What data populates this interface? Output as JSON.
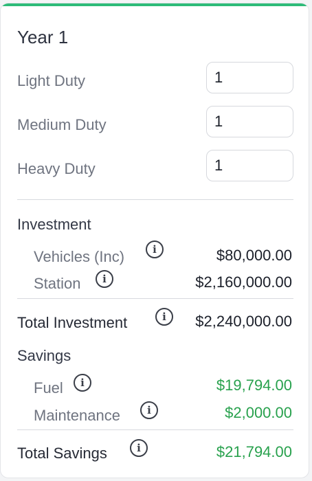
{
  "title": "Year 1",
  "inputs": [
    {
      "label": "Light Duty",
      "value": "1"
    },
    {
      "label": "Medium Duty",
      "value": "1"
    },
    {
      "label": "Heavy Duty",
      "value": "1"
    }
  ],
  "investment": {
    "heading": "Investment",
    "vehicles_label": "Vehicles (Inc)",
    "vehicles_value": "$80,000.00",
    "station_label": "Station",
    "station_value": "$2,160,000.00"
  },
  "total_investment": {
    "label": "Total Investment",
    "value": "$2,240,000.00"
  },
  "savings": {
    "heading": "Savings",
    "fuel_label": "Fuel",
    "fuel_value": "$19,794.00",
    "maintenance_label": "Maintenance",
    "maintenance_value": "$2,000.00"
  },
  "total_savings": {
    "label": "Total Savings",
    "value": "$21,794.00"
  },
  "info_glyph": "i",
  "colors": {
    "accent": "#2dbb78",
    "positive": "#28a14d"
  }
}
